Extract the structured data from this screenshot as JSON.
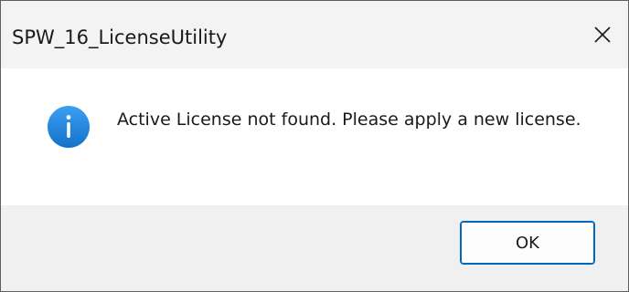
{
  "window": {
    "title": "SPW_16_LicenseUtility",
    "close_icon": "close-icon"
  },
  "dialog": {
    "icon": "info-icon",
    "message": "Active License not found. Please apply a new license."
  },
  "buttons": {
    "ok_label": "OK"
  },
  "colors": {
    "icon_blue_top": "#3aa0f2",
    "icon_blue_bottom": "#1371c9",
    "button_border": "#0067c0",
    "footer_bg": "#f0f0f0"
  }
}
